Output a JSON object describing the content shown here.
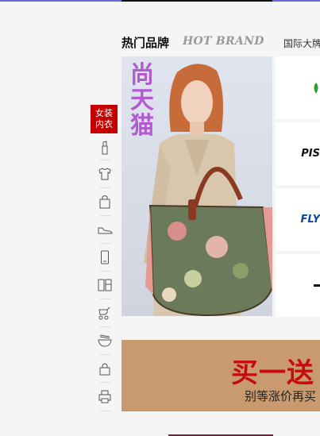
{
  "header": {
    "title": "热门品牌",
    "subtitle": "HOT BRAND",
    "intl_link": "国际大牌"
  },
  "sidebar": {
    "badge_line1": "女装",
    "badge_line2": "内衣",
    "icons": [
      "lipstick-icon",
      "tshirt-icon",
      "bag-icon",
      "shoe-icon",
      "phone-icon",
      "fridge-icon",
      "stroller-icon",
      "bowl-icon",
      "lock-icon",
      "printer-icon"
    ]
  },
  "hero": {
    "title_chars": [
      "尚",
      "天",
      "猫"
    ]
  },
  "brands": [
    {
      "label": "",
      "color": "#2aa02a"
    },
    {
      "label": "PIS",
      "color": "#111111"
    },
    {
      "label": "FLY",
      "color": "#0a4a9a"
    },
    {
      "label": "",
      "color": "#111111"
    }
  ],
  "promo": {
    "title": "买一送",
    "subtitle": "别等涨价再买"
  }
}
